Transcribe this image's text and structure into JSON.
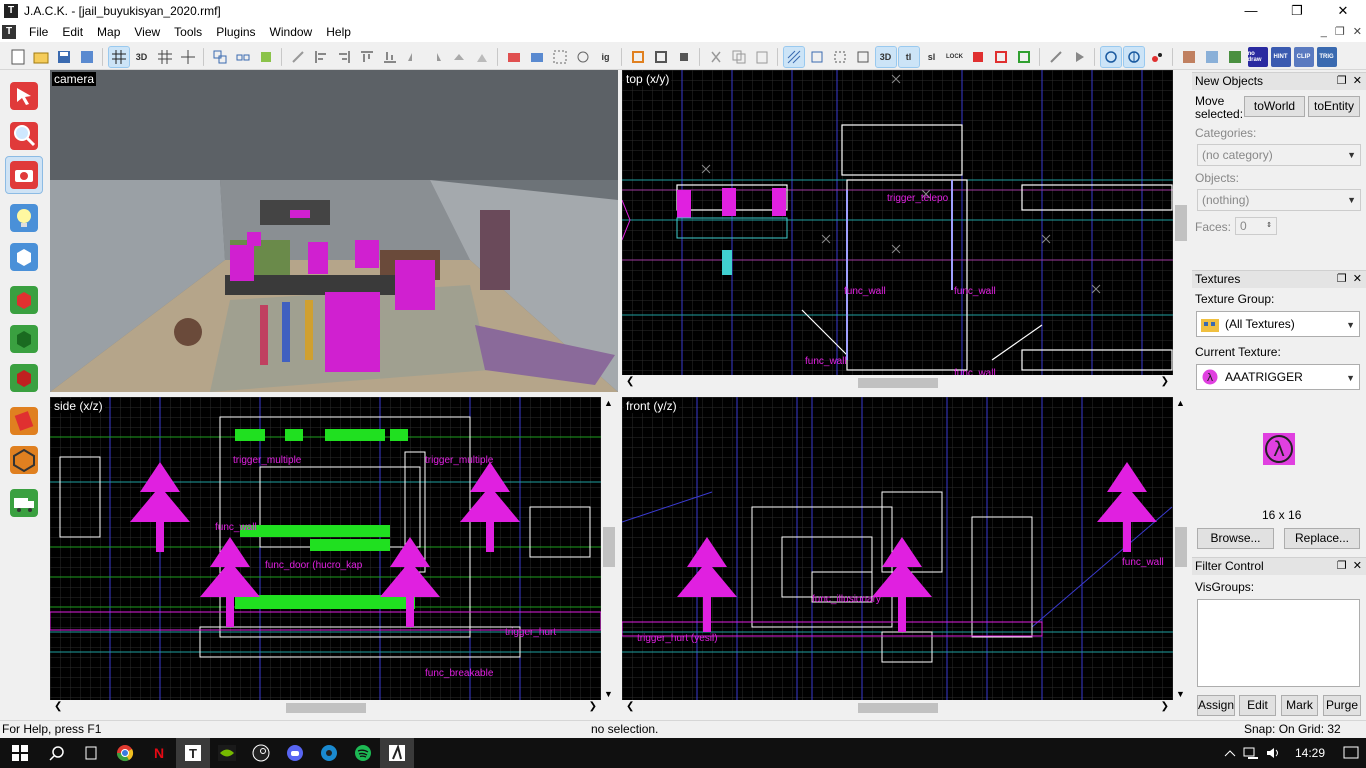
{
  "window": {
    "title": "J.A.C.K. - [jail_buyukisyan_2020.rmf]",
    "app_icon": "T"
  },
  "window_controls": {
    "minimize": "—",
    "maximize": "❐",
    "close": "✕"
  },
  "menu": [
    "File",
    "Edit",
    "Map",
    "View",
    "Tools",
    "Plugins",
    "Window",
    "Help"
  ],
  "mdi_controls": [
    "_",
    "❐",
    "✕"
  ],
  "toolbar": {
    "labels": [
      "3D",
      "ig",
      "3D",
      "tl",
      "sl",
      "LOCK",
      "no draw",
      "HINT",
      "CLIP",
      "TRIG"
    ]
  },
  "left_tools": [
    "selection-tool",
    "magnify-tool",
    "camera-tool",
    "entity-tool",
    "block-tool",
    "texture-application-tool",
    "apply-current-texture-tool",
    "decal-tool",
    "overlay-tool",
    "clipping-tool",
    "vertex-manipulation-tool",
    "path-tool"
  ],
  "viewports": {
    "camera": {
      "label": "camera"
    },
    "top": {
      "label": "top (x/y)",
      "entities": [
        "trigger_telepo",
        "func_wall",
        "func_wall",
        "func_wall",
        "func_wall"
      ]
    },
    "side": {
      "label": "side (x/z)",
      "entities": [
        "trigger_hurt",
        "trigger_multiple",
        "func_wall",
        "func_door (hucro_kap",
        "func_breakable",
        "trigger_hurt"
      ]
    },
    "front": {
      "label": "front (y/z)",
      "entities": [
        "func_illusionary",
        "trigger_hurt (yesil)",
        "func_wall"
      ]
    }
  },
  "panels": {
    "new_objects": {
      "title": "New Objects",
      "move_selected_label": "Move\nselected:",
      "to_world": "toWorld",
      "to_entity": "toEntity",
      "categories_label": "Categories:",
      "categories_value": "(no category)",
      "objects_label": "Objects:",
      "objects_value": "(nothing)",
      "faces_label": "Faces:",
      "faces_value": "0"
    },
    "textures": {
      "title": "Textures",
      "group_label": "Texture Group:",
      "group_value": "(All Textures)",
      "current_label": "Current Texture:",
      "current_value": "AAATRIGGER",
      "size": "16 x 16",
      "browse": "Browse...",
      "replace": "Replace..."
    },
    "filter": {
      "title": "Filter Control",
      "visgroups_label": "VisGroups:",
      "assign": "Assign",
      "edit": "Edit",
      "mark": "Mark",
      "purge": "Purge"
    },
    "panel_controls": {
      "dock": "❐",
      "close": "✕"
    }
  },
  "status": {
    "help": "For Help, press F1",
    "selection": "no selection.",
    "snap": "Snap: On Grid: 32"
  },
  "taskbar": {
    "time": "14:29",
    "apps": [
      "start-icon",
      "search-icon",
      "task-view-icon",
      "chrome-icon",
      "netflix-icon",
      "jack-icon",
      "nvidia-icon",
      "steam-icon",
      "discord-icon",
      "edge-icon",
      "spotify-icon",
      "kade-icon"
    ]
  },
  "colors": {
    "entity": "#e020e0",
    "grid": "#2c2c2c",
    "brush": "#ffffff",
    "accent": "#cce4f7"
  }
}
